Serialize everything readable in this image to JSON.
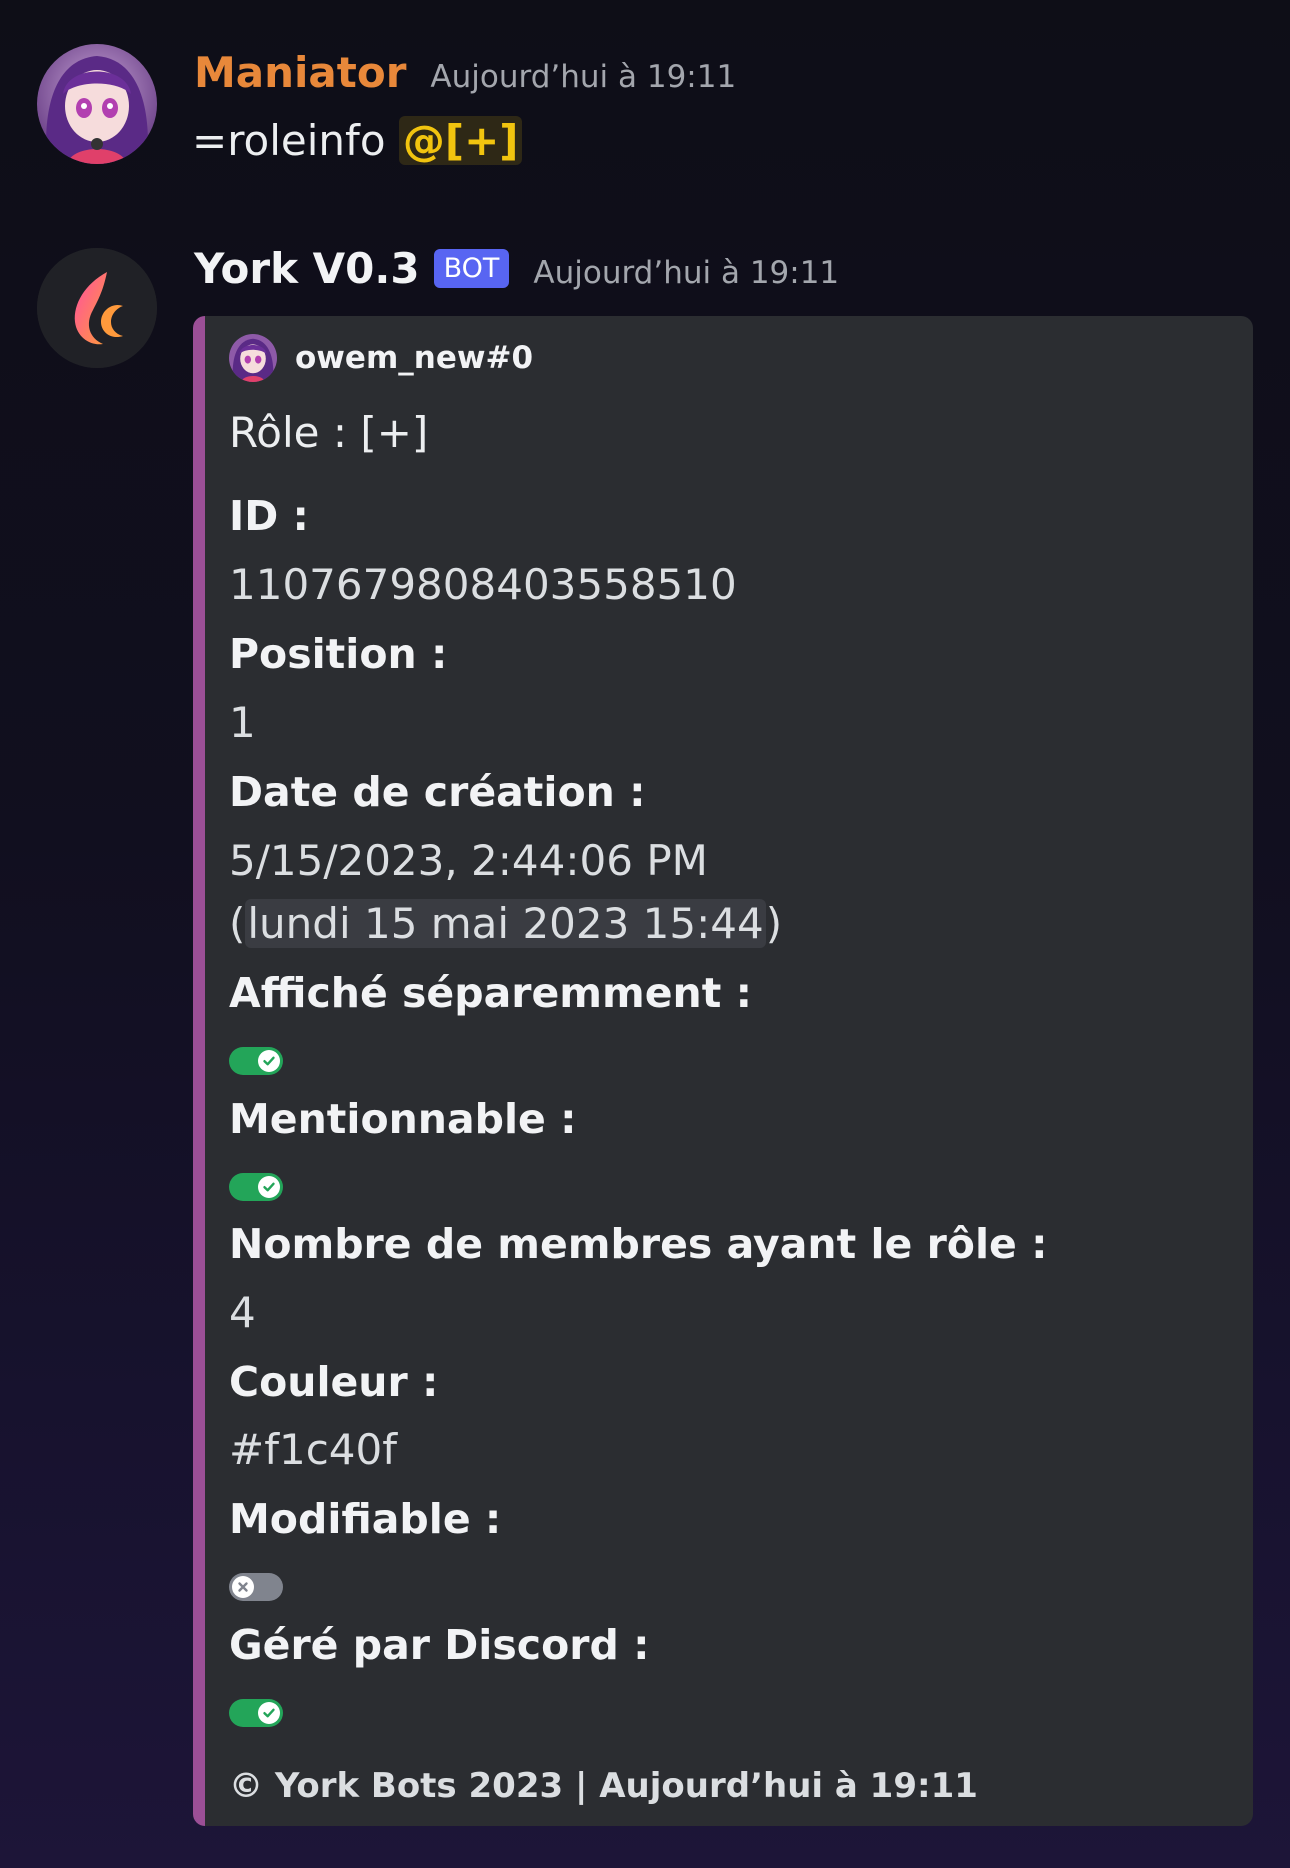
{
  "messages": [
    {
      "username": "Maniator",
      "username_color": "#e8883a",
      "timestamp": "Aujourd’hui à 19:11",
      "text": "=roleinfo ",
      "mention": "@[+]",
      "mention_color": "#f1c40f"
    },
    {
      "username": "York V0.3",
      "username_color": "#f2f3f5",
      "badge": "BOT",
      "timestamp": "Aujourd’hui à 19:11"
    }
  ],
  "embed": {
    "accent_color": "#9b4f96",
    "author": "owem_new#0",
    "description": "Rôle : [+]",
    "fields": {
      "id": {
        "name": "ID :",
        "value": "1107679808403558510"
      },
      "position": {
        "name": "Position :",
        "value": "1"
      },
      "created": {
        "name": "Date de création :",
        "value": "5/15/2023, 2:44:06 PM",
        "paren_open": "(",
        "local_date": "lundi 15 mai 2023 15:44",
        "paren_close": ")"
      },
      "hoist": {
        "name": "Affiché séparemment :",
        "enabled": true,
        "icon": "check-icon"
      },
      "mentionable": {
        "name": "Mentionnable :",
        "enabled": true,
        "icon": "check-icon"
      },
      "members": {
        "name": "Nombre de membres ayant le rôle :",
        "value": "4"
      },
      "color": {
        "name": "Couleur :",
        "value": "#f1c40f"
      },
      "editable": {
        "name": "Modifiable :",
        "enabled": false,
        "icon": "x-icon"
      },
      "managed": {
        "name": "Géré par Discord :",
        "enabled": true,
        "icon": "check-icon"
      }
    },
    "footer": "© York Bots 2023 | Aujourd’hui à 19:11"
  },
  "colors": {
    "bot_badge": "#5865f2",
    "toggle_on": "#23a559",
    "toggle_off": "#80848e",
    "embed_background": "#2b2d31"
  }
}
